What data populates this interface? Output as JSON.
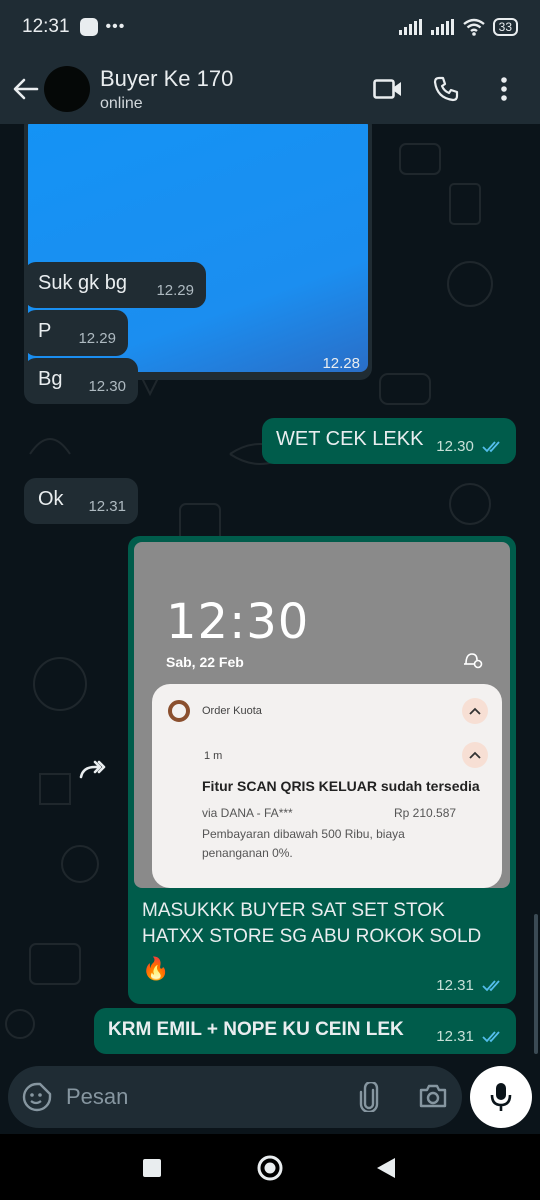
{
  "status_bar": {
    "time": "12:31",
    "more": "•••",
    "battery": "33"
  },
  "header": {
    "contact_name": "Buyer Ke 170",
    "contact_status": "online"
  },
  "messages": [
    {
      "side": "in",
      "type": "image",
      "time": "12.28"
    },
    {
      "side": "in",
      "text": "Suk gk bg",
      "time": "12.29"
    },
    {
      "side": "in",
      "text": "P",
      "time": "12.29"
    },
    {
      "side": "in",
      "text": "Bg",
      "time": "12.30"
    },
    {
      "side": "out",
      "text": "WET CEK LEKK",
      "time": "12.30",
      "read": true
    },
    {
      "side": "in",
      "text": "Ok",
      "time": "12.31"
    },
    {
      "side": "out",
      "type": "image-caption",
      "screenshot": {
        "clock": "12:30",
        "date": "Sab, 22 Feb",
        "notif_app": "Order Kuota",
        "notif_time": "1 m",
        "notif_title": "Fitur SCAN QRIS KELUAR sudah tersedia",
        "notif_via": "via DANA - FA***",
        "notif_amount": "Rp 210.587",
        "notif_body": "Pembayaran dibawah 500 Ribu, biaya penanganan 0%."
      },
      "text": "MASUKKK BUYER SAT SET STOK HATXX STORE SG ABU ROKOK SOLD",
      "emoji": "🔥",
      "time": "12.31",
      "read": true
    },
    {
      "side": "out",
      "text": "KRM EMIL + NOPE KU CEIN LEK",
      "time": "12.31",
      "read": true
    }
  ],
  "input": {
    "placeholder": "Pesan",
    "value": ""
  },
  "colors": {
    "incoming": "#202c33",
    "outgoing": "#005c4b",
    "read_tick": "#53bdeb",
    "background": "#0b141a"
  }
}
